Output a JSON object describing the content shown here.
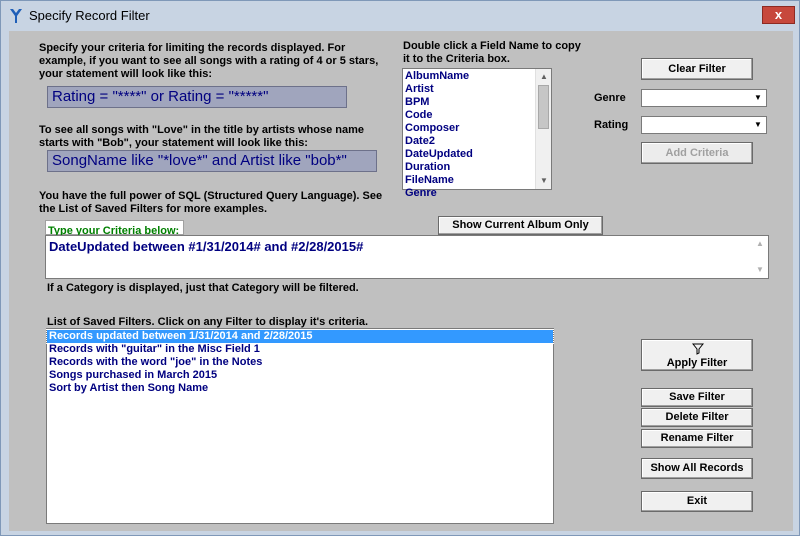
{
  "window": {
    "title": "Specify Record Filter",
    "close_label": "x"
  },
  "intro": {
    "line1": "Specify your criteria for limiting the records displayed.  For",
    "line2": "example, if you want to see all songs with a rating of 4 or 5 stars,",
    "line3": "your statement will look like this:"
  },
  "example1": "Rating = \"****\" or Rating = \"*****\"",
  "love_text": {
    "line1": "To see all songs with \"Love\" in the title by artists whose name",
    "line2": "starts with \"Bob\", your statement will look like this:"
  },
  "example2": "SongName like \"*love*\" and Artist like \"bob*\"",
  "sql_text": {
    "line1": "You have the full power of SQL (Structured Query Language).  See",
    "line2": "the List of Saved Filters for more examples."
  },
  "field_list": {
    "header1": "Double click a Field Name to copy",
    "header2": "it to the Criteria box.",
    "items": [
      "AlbumName",
      "Artist",
      "BPM",
      "Code",
      "Composer",
      "Date2",
      "DateUpdated",
      "Duration",
      "FileName",
      "Genre"
    ]
  },
  "buttons": {
    "clear_filter": "Clear Filter",
    "add_criteria": "Add Criteria",
    "show_current_album": "Show Current Album Only",
    "apply_filter": "Apply Filter",
    "save_filter": "Save Filter",
    "delete_filter": "Delete Filter",
    "rename_filter": "Rename Filter",
    "show_all_records": "Show All Records",
    "exit": "Exit"
  },
  "filters": {
    "genre_label": "Genre",
    "genre_value": "",
    "rating_label": "Rating",
    "rating_value": ""
  },
  "criteria": {
    "label": "Type your Criteria below:",
    "value": "DateUpdated between #1/31/2014# and #2/28/2015#",
    "note": "If a Category is displayed, just that Category will be filtered."
  },
  "saved_filters": {
    "header": "List of Saved Filters.  Click on any Filter to display it's criteria.",
    "items": [
      "Records updated between 1/31/2014 and 2/28/2015",
      "Records with \"guitar\" in the Misc Field 1",
      "Records with the word \"joe\" in the Notes",
      "Songs purchased in March 2015",
      "Sort by Artist then Song Name"
    ],
    "selected_index": 0
  },
  "icons": {
    "app": "app-logo-icon",
    "apply": "filter-icon",
    "close": "close-icon",
    "dropdown": "chevron-down-icon",
    "scroll_up": "scroll-up-arrow-icon",
    "scroll_down": "scroll-down-arrow-icon"
  },
  "colors": {
    "list_text": "#000080",
    "selection": "#3399ff",
    "criteria_label": "#008000",
    "example_bg": "#a0a5bd",
    "close_red": "#c7483c"
  }
}
